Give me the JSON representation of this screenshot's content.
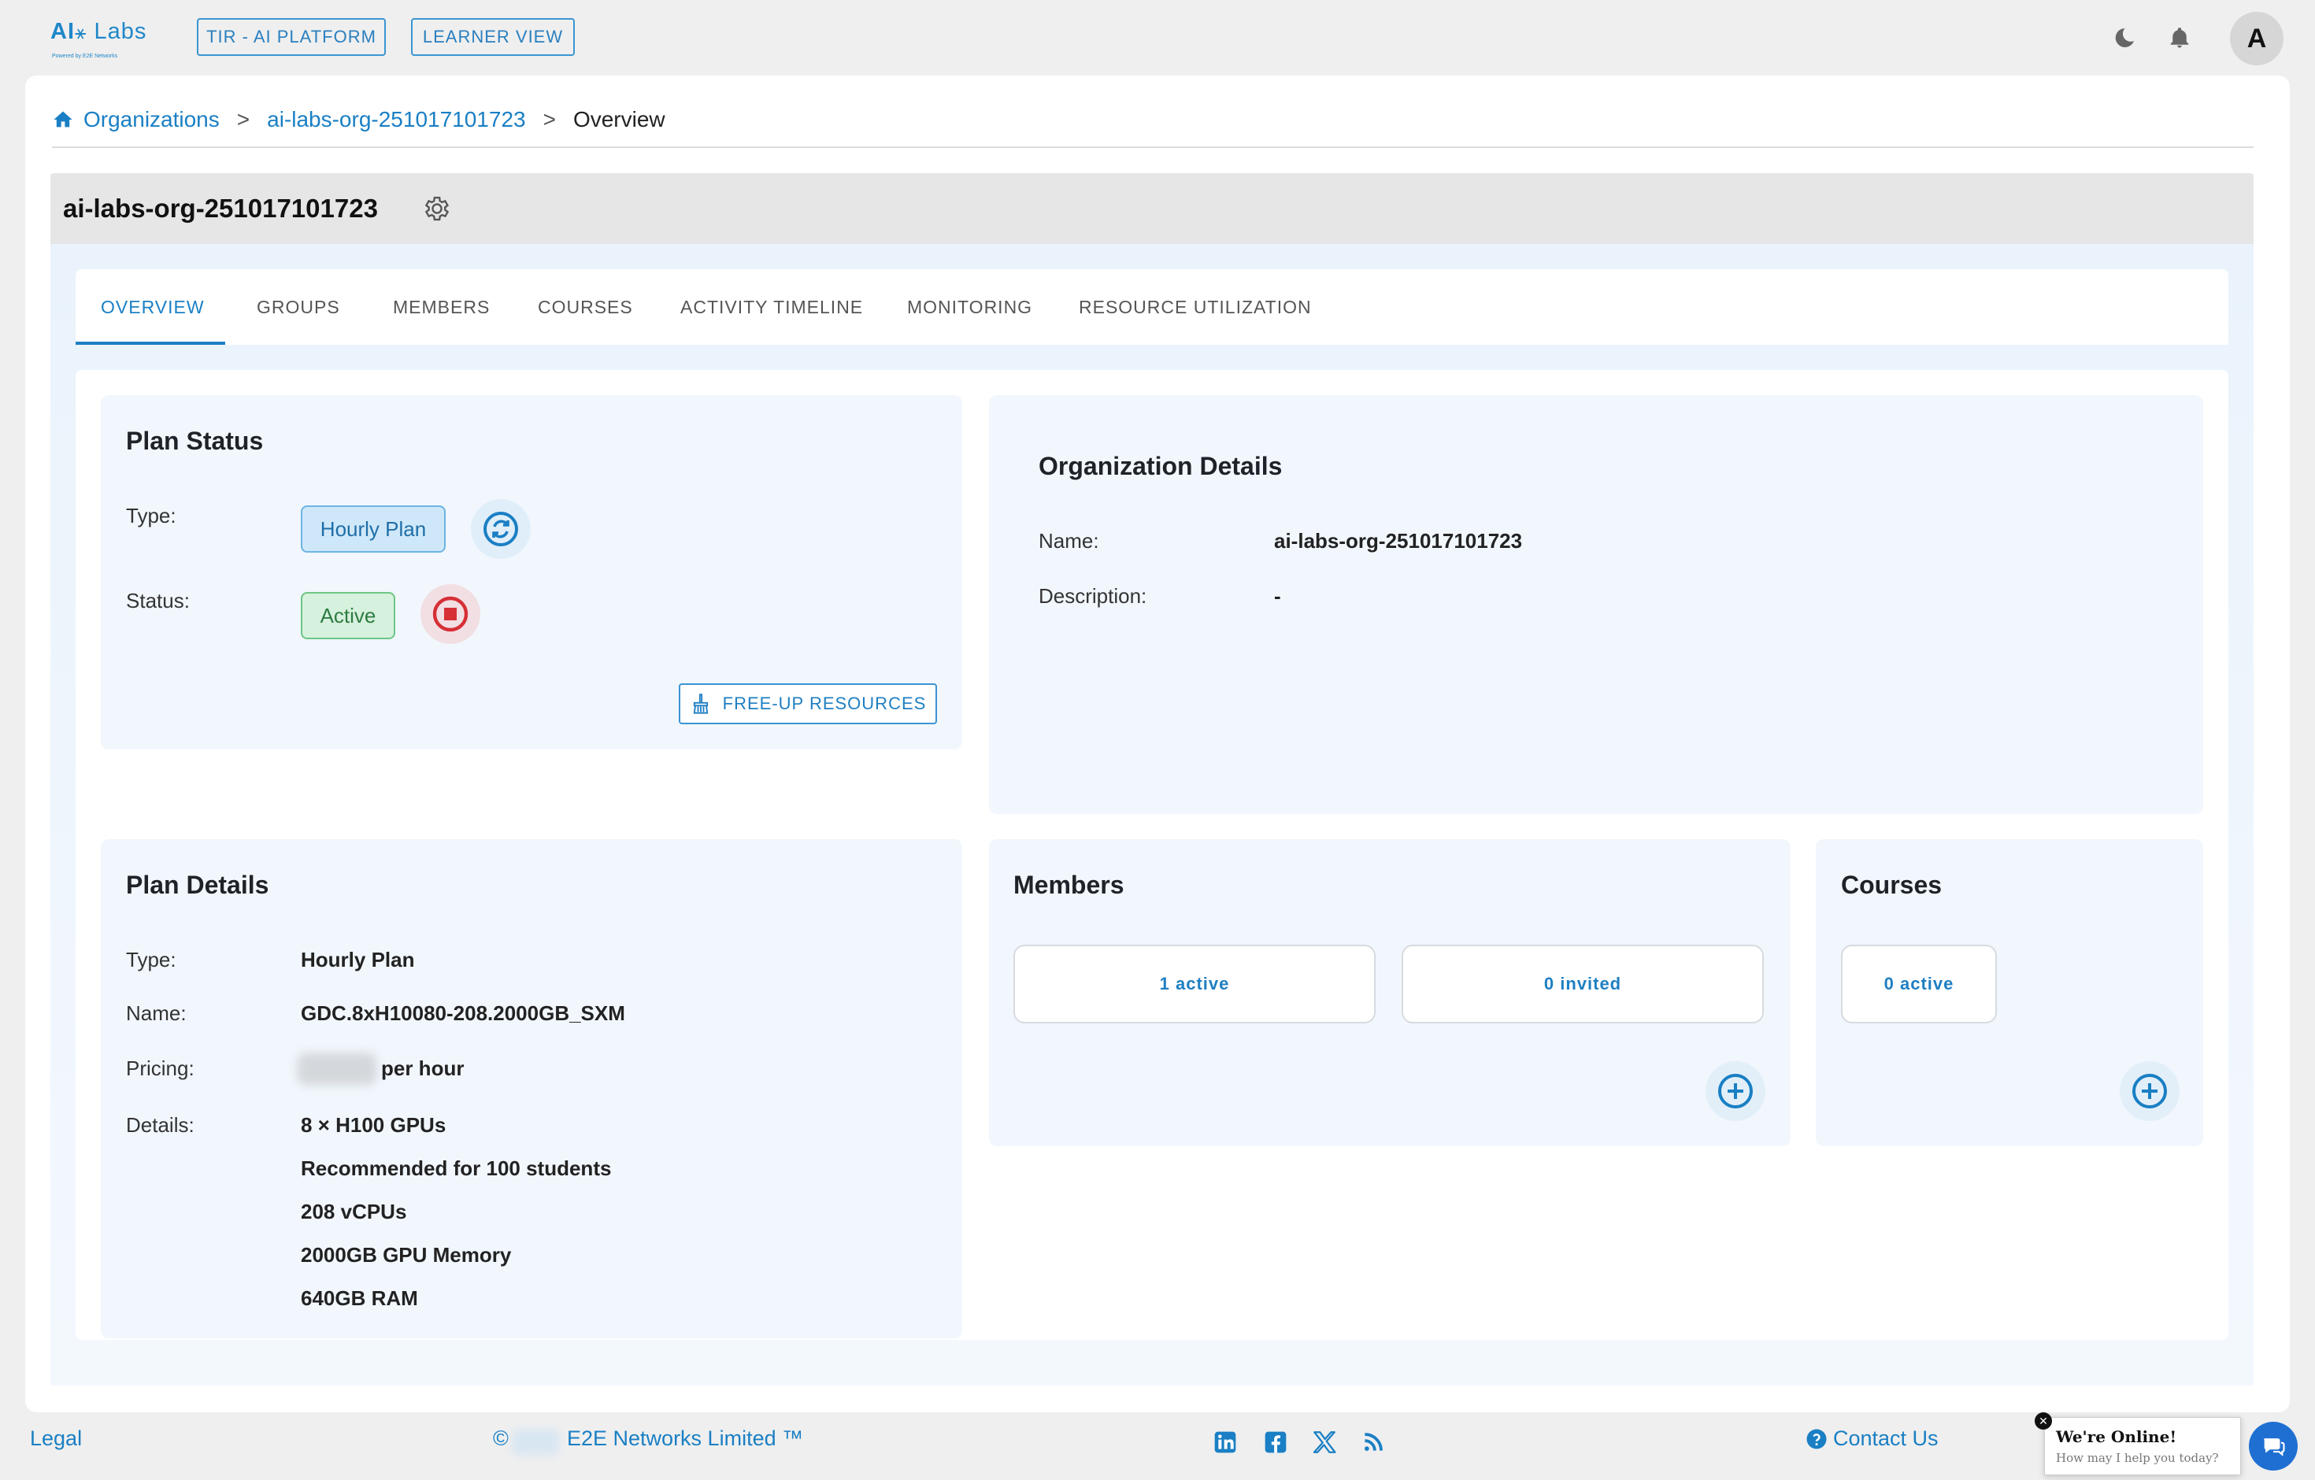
{
  "header": {
    "logo_text": "AI",
    "logo_text2": "Labs",
    "logo_sub": "Powered by E2E Networks",
    "btn_platform": "TIR - AI PLATFORM",
    "btn_learner": "LEARNER VIEW",
    "icons": [
      "moon-icon",
      "bell-icon"
    ],
    "avatar_letter": "A"
  },
  "breadcrumb": {
    "root": "Organizations",
    "sep1": ">",
    "org": "ai-labs-org-251017101723",
    "sep2": ">",
    "current": "Overview"
  },
  "org": {
    "title": "ai-labs-org-251017101723"
  },
  "tabs": [
    "OVERVIEW",
    "GROUPS",
    "MEMBERS",
    "COURSES",
    "ACTIVITY TIMELINE",
    "MONITORING",
    "RESOURCE UTILIZATION"
  ],
  "active_tab": "OVERVIEW",
  "plan_status": {
    "title": "Plan Status",
    "type_label": "Type:",
    "type_value": "Hourly Plan",
    "status_label": "Status:",
    "status_value": "Active",
    "free_up_label": "FREE-UP RESOURCES"
  },
  "org_details": {
    "title": "Organization Details",
    "name_label": "Name:",
    "name_value": "ai-labs-org-251017101723",
    "desc_label": "Description:",
    "desc_value": "-"
  },
  "plan_details": {
    "title": "Plan Details",
    "type_label": "Type:",
    "type_value": "Hourly Plan",
    "name_label": "Name:",
    "name_value": "GDC.8xH10080-208.2000GB_SXM",
    "pricing_label": "Pricing:",
    "pricing_suffix": "per hour",
    "details_label": "Details:",
    "details": [
      "8 × H100 GPUs",
      "Recommended for 100 students",
      "208 vCPUs",
      "2000GB GPU Memory",
      "640GB RAM"
    ]
  },
  "members": {
    "title": "Members",
    "active": "1 active",
    "invited": "0 invited"
  },
  "courses": {
    "title": "Courses",
    "active": "0 active"
  },
  "footer": {
    "legal": "Legal",
    "copyright_symbol": "©",
    "company": "E2E Networks Limited ™",
    "social": [
      "linkedin-icon",
      "facebook-icon",
      "x-icon",
      "rss-icon"
    ],
    "contact": "Contact Us"
  },
  "chat": {
    "title": "We're Online!",
    "subtitle": "How may I help you today?"
  },
  "colors": {
    "accent": "#1a7fc4",
    "page_bg": "#efefef",
    "card_bg": "#f1f7fd",
    "status_green": "#6cc686",
    "stop_red": "#d62f36"
  }
}
